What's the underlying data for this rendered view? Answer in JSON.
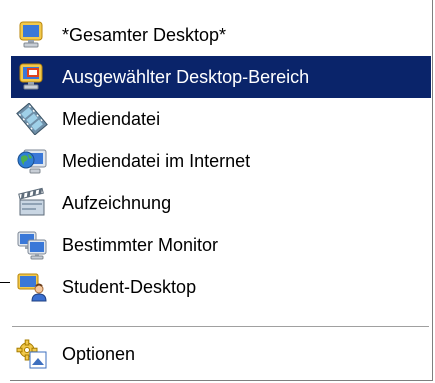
{
  "menu": {
    "items": [
      {
        "label": "*Gesamter Desktop*",
        "icon": "desktop-monitor-icon"
      },
      {
        "label": "Ausgewählter Desktop-Bereich",
        "icon": "desktop-region-icon",
        "selected": true
      },
      {
        "label": "Mediendatei",
        "icon": "film-reel-icon"
      },
      {
        "label": "Mediendatei im Internet",
        "icon": "globe-monitor-icon"
      },
      {
        "label": "Aufzeichnung",
        "icon": "clapperboard-icon"
      },
      {
        "label": "Bestimmter Monitor",
        "icon": "multi-monitor-icon"
      },
      {
        "label": "Student-Desktop",
        "icon": "student-monitor-icon"
      },
      {
        "label": "Optionen",
        "icon": "options-gear-icon"
      }
    ],
    "selected_color": "#0a246a"
  }
}
